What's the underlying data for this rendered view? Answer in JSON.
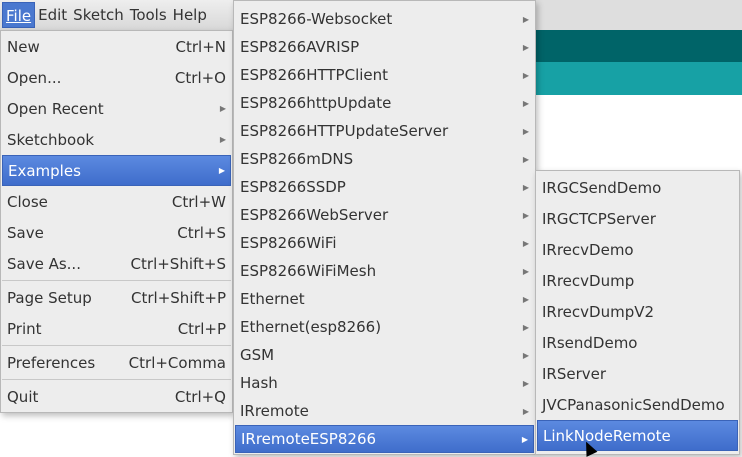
{
  "menubar": {
    "items": [
      "File",
      "Edit",
      "Sketch",
      "Tools",
      "Help"
    ]
  },
  "file_menu": [
    {
      "label": "New",
      "shortcut": "Ctrl+N"
    },
    {
      "label": "Open...",
      "shortcut": "Ctrl+O"
    },
    {
      "label": "Open Recent",
      "submenu": true
    },
    {
      "label": "Sketchbook",
      "submenu": true
    },
    {
      "label": "Examples",
      "submenu": true,
      "selected": true
    },
    {
      "label": "Close",
      "shortcut": "Ctrl+W"
    },
    {
      "label": "Save",
      "shortcut": "Ctrl+S"
    },
    {
      "label": "Save As...",
      "shortcut": "Ctrl+Shift+S"
    },
    {
      "label": "Page Setup",
      "shortcut": "Ctrl+Shift+P"
    },
    {
      "label": "Print",
      "shortcut": "Ctrl+P"
    },
    {
      "label": "Preferences",
      "shortcut": "Ctrl+Comma"
    },
    {
      "label": "Quit",
      "shortcut": "Ctrl+Q"
    }
  ],
  "examples_menu": [
    "ESP8266-Websocket",
    "ESP8266AVRISP",
    "ESP8266HTTPClient",
    "ESP8266httpUpdate",
    "ESP8266HTTPUpdateServer",
    "ESP8266mDNS",
    "ESP8266SSDP",
    "ESP8266WebServer",
    "ESP8266WiFi",
    "ESP8266WiFiMesh",
    "Ethernet",
    "Ethernet(esp8266)",
    "GSM",
    "Hash",
    "IRremote",
    "IRremoteESP8266"
  ],
  "irremote_menu": [
    "IRGCSendDemo",
    "IRGCTCPServer",
    "IRrecvDemo",
    "IRrecvDump",
    "IRrecvDumpV2",
    "IRsendDemo",
    "IRServer",
    "JVCPanasonicSendDemo",
    "LinkNodeRemote"
  ]
}
